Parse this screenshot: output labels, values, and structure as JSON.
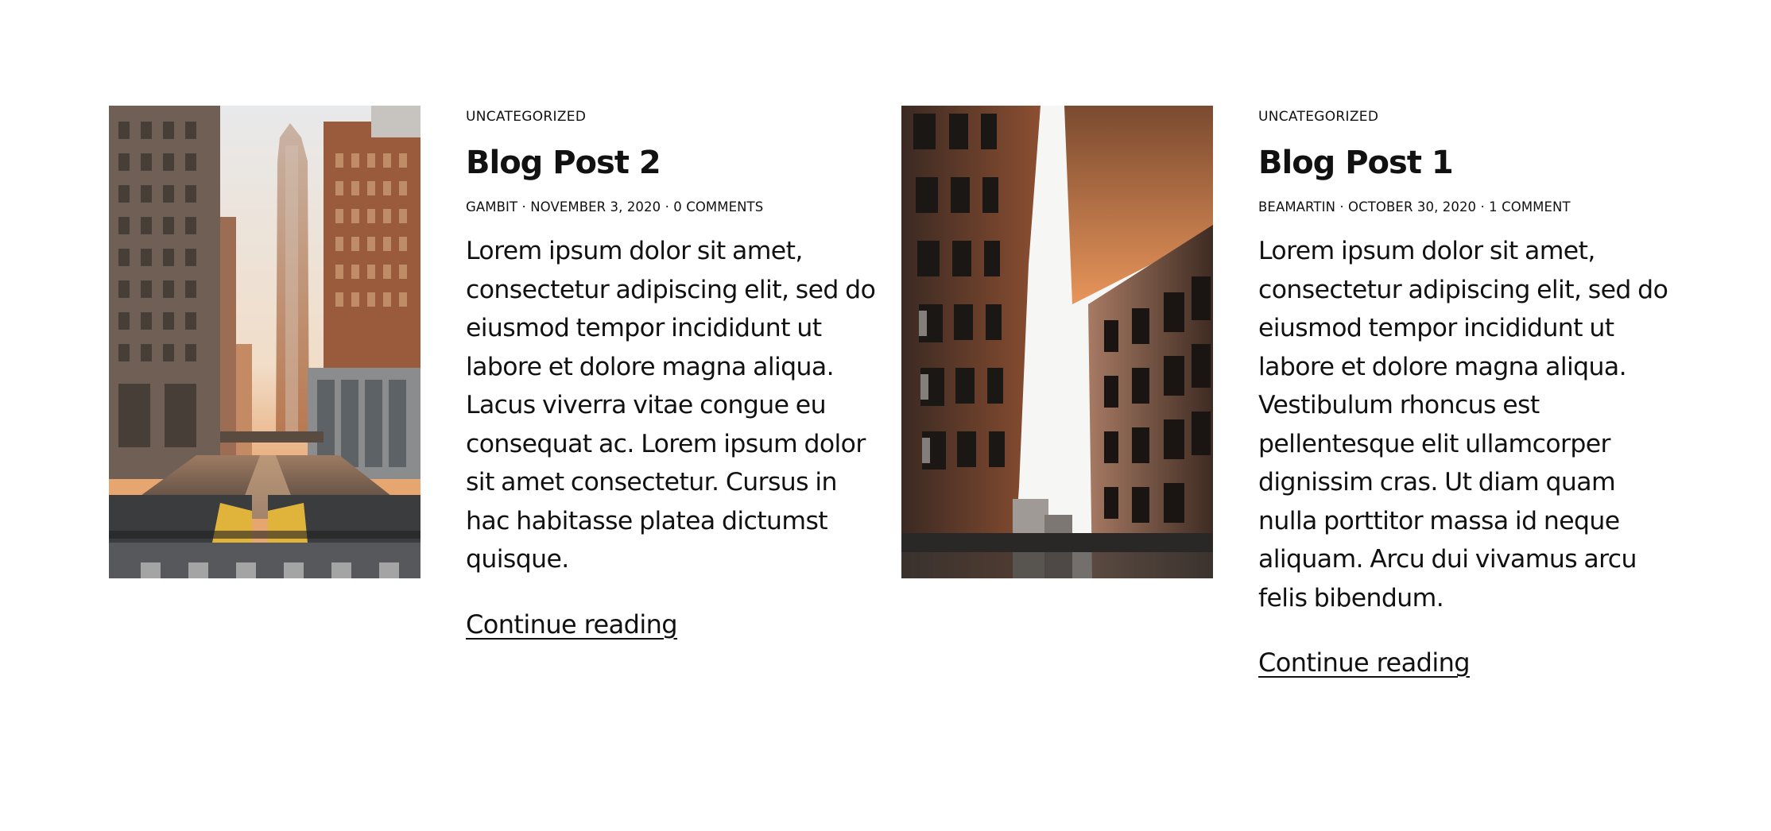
{
  "posts": [
    {
      "category": "UNCATEGORIZED",
      "title": "Blog Post 2",
      "meta": "GAMBIT · NOVEMBER 3, 2020 · 0 COMMENTS",
      "excerpt_lines": [
        "Lorem ipsum dolor sit amet,",
        "consectetur adipiscing elit, sed do",
        "eiusmod tempor incididunt ut",
        "labore et dolore magna aliqua.",
        "Lacus viverra vitae congue eu",
        "consequat ac. Lorem ipsum dolor",
        "sit amet consectetur. Cursus in",
        "hac habitasse platea dictumst",
        "quisque."
      ],
      "read_more": "Continue reading"
    },
    {
      "category": "UNCATEGORIZED",
      "title": "Blog Post 1",
      "meta": "BEAMARTIN · OCTOBER 30, 2020 · 1 COMMENT",
      "excerpt_lines": [
        "Lorem ipsum dolor sit amet,",
        "consectetur adipiscing elit, sed do",
        "eiusmod tempor incididunt ut",
        "labore et dolore magna aliqua.",
        "Vestibulum rhoncus est",
        "pellentesque elit ullamcorper",
        "dignissim cras. Ut diam quam",
        "nulla porttitor massa id neque",
        "aliquam. Arcu dui vivamus arcu",
        "felis bibendum."
      ],
      "read_more": "Continue reading"
    }
  ],
  "colors": {
    "text": "#111111",
    "background": "#ffffff"
  }
}
